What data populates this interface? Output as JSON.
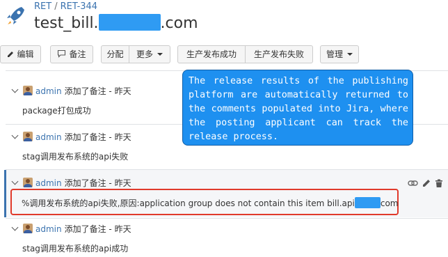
{
  "project": {
    "icon": "rocket-icon",
    "breadcrumb": [
      "RET",
      "RET-344"
    ],
    "breadcrumb_separator": "/",
    "title_prefix": "test_bill.",
    "title_suffix": ".com",
    "redaction_color": "#2f9bf3"
  },
  "toolbar": {
    "edit": "编辑",
    "comment": "备注",
    "assign": "分配",
    "more": "更多",
    "release_success": "生产发布成功",
    "release_fail": "生产发布失败",
    "admin": "管理"
  },
  "entries": [
    {
      "user": "admin",
      "action": "添加了备注 - 昨天",
      "text": "package打包成功"
    },
    {
      "user": "admin",
      "action": "添加了备注 - 昨天",
      "text": "stag调用发布系统的api失败"
    },
    {
      "user": "admin",
      "action": "添加了备注 - 昨天",
      "text_prefix": "%调用发布系统的api失败,原因:application group does not contain this item bill.api",
      "text_suffix": "com",
      "highlighted": true
    },
    {
      "user": "admin",
      "action": "添加了备注 - 昨天",
      "text": "stag调用发布系统的api成功"
    }
  ],
  "callout": {
    "text": "The release results of the publishing platform are automatically returned to the comments populated into Jira, where the posting applicant can track the release process."
  },
  "colors": {
    "link": "#3b73af",
    "highlight_border": "#e03a2b",
    "callout_bg": "#1e90f0"
  }
}
